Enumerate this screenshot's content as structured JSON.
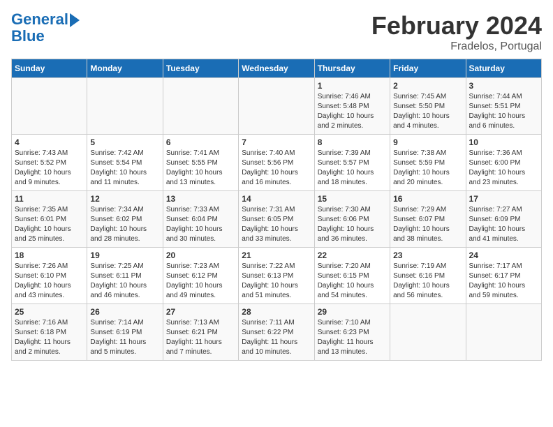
{
  "logo": {
    "line1": "General",
    "line2": "Blue"
  },
  "title": "February 2024",
  "subtitle": "Fradelos, Portugal",
  "weekdays": [
    "Sunday",
    "Monday",
    "Tuesday",
    "Wednesday",
    "Thursday",
    "Friday",
    "Saturday"
  ],
  "weeks": [
    [
      {
        "day": "",
        "info": ""
      },
      {
        "day": "",
        "info": ""
      },
      {
        "day": "",
        "info": ""
      },
      {
        "day": "",
        "info": ""
      },
      {
        "day": "1",
        "info": "Sunrise: 7:46 AM\nSunset: 5:48 PM\nDaylight: 10 hours\nand 2 minutes."
      },
      {
        "day": "2",
        "info": "Sunrise: 7:45 AM\nSunset: 5:50 PM\nDaylight: 10 hours\nand 4 minutes."
      },
      {
        "day": "3",
        "info": "Sunrise: 7:44 AM\nSunset: 5:51 PM\nDaylight: 10 hours\nand 6 minutes."
      }
    ],
    [
      {
        "day": "4",
        "info": "Sunrise: 7:43 AM\nSunset: 5:52 PM\nDaylight: 10 hours\nand 9 minutes."
      },
      {
        "day": "5",
        "info": "Sunrise: 7:42 AM\nSunset: 5:54 PM\nDaylight: 10 hours\nand 11 minutes."
      },
      {
        "day": "6",
        "info": "Sunrise: 7:41 AM\nSunset: 5:55 PM\nDaylight: 10 hours\nand 13 minutes."
      },
      {
        "day": "7",
        "info": "Sunrise: 7:40 AM\nSunset: 5:56 PM\nDaylight: 10 hours\nand 16 minutes."
      },
      {
        "day": "8",
        "info": "Sunrise: 7:39 AM\nSunset: 5:57 PM\nDaylight: 10 hours\nand 18 minutes."
      },
      {
        "day": "9",
        "info": "Sunrise: 7:38 AM\nSunset: 5:59 PM\nDaylight: 10 hours\nand 20 minutes."
      },
      {
        "day": "10",
        "info": "Sunrise: 7:36 AM\nSunset: 6:00 PM\nDaylight: 10 hours\nand 23 minutes."
      }
    ],
    [
      {
        "day": "11",
        "info": "Sunrise: 7:35 AM\nSunset: 6:01 PM\nDaylight: 10 hours\nand 25 minutes."
      },
      {
        "day": "12",
        "info": "Sunrise: 7:34 AM\nSunset: 6:02 PM\nDaylight: 10 hours\nand 28 minutes."
      },
      {
        "day": "13",
        "info": "Sunrise: 7:33 AM\nSunset: 6:04 PM\nDaylight: 10 hours\nand 30 minutes."
      },
      {
        "day": "14",
        "info": "Sunrise: 7:31 AM\nSunset: 6:05 PM\nDaylight: 10 hours\nand 33 minutes."
      },
      {
        "day": "15",
        "info": "Sunrise: 7:30 AM\nSunset: 6:06 PM\nDaylight: 10 hours\nand 36 minutes."
      },
      {
        "day": "16",
        "info": "Sunrise: 7:29 AM\nSunset: 6:07 PM\nDaylight: 10 hours\nand 38 minutes."
      },
      {
        "day": "17",
        "info": "Sunrise: 7:27 AM\nSunset: 6:09 PM\nDaylight: 10 hours\nand 41 minutes."
      }
    ],
    [
      {
        "day": "18",
        "info": "Sunrise: 7:26 AM\nSunset: 6:10 PM\nDaylight: 10 hours\nand 43 minutes."
      },
      {
        "day": "19",
        "info": "Sunrise: 7:25 AM\nSunset: 6:11 PM\nDaylight: 10 hours\nand 46 minutes."
      },
      {
        "day": "20",
        "info": "Sunrise: 7:23 AM\nSunset: 6:12 PM\nDaylight: 10 hours\nand 49 minutes."
      },
      {
        "day": "21",
        "info": "Sunrise: 7:22 AM\nSunset: 6:13 PM\nDaylight: 10 hours\nand 51 minutes."
      },
      {
        "day": "22",
        "info": "Sunrise: 7:20 AM\nSunset: 6:15 PM\nDaylight: 10 hours\nand 54 minutes."
      },
      {
        "day": "23",
        "info": "Sunrise: 7:19 AM\nSunset: 6:16 PM\nDaylight: 10 hours\nand 56 minutes."
      },
      {
        "day": "24",
        "info": "Sunrise: 7:17 AM\nSunset: 6:17 PM\nDaylight: 10 hours\nand 59 minutes."
      }
    ],
    [
      {
        "day": "25",
        "info": "Sunrise: 7:16 AM\nSunset: 6:18 PM\nDaylight: 11 hours\nand 2 minutes."
      },
      {
        "day": "26",
        "info": "Sunrise: 7:14 AM\nSunset: 6:19 PM\nDaylight: 11 hours\nand 5 minutes."
      },
      {
        "day": "27",
        "info": "Sunrise: 7:13 AM\nSunset: 6:21 PM\nDaylight: 11 hours\nand 7 minutes."
      },
      {
        "day": "28",
        "info": "Sunrise: 7:11 AM\nSunset: 6:22 PM\nDaylight: 11 hours\nand 10 minutes."
      },
      {
        "day": "29",
        "info": "Sunrise: 7:10 AM\nSunset: 6:23 PM\nDaylight: 11 hours\nand 13 minutes."
      },
      {
        "day": "",
        "info": ""
      },
      {
        "day": "",
        "info": ""
      }
    ]
  ]
}
